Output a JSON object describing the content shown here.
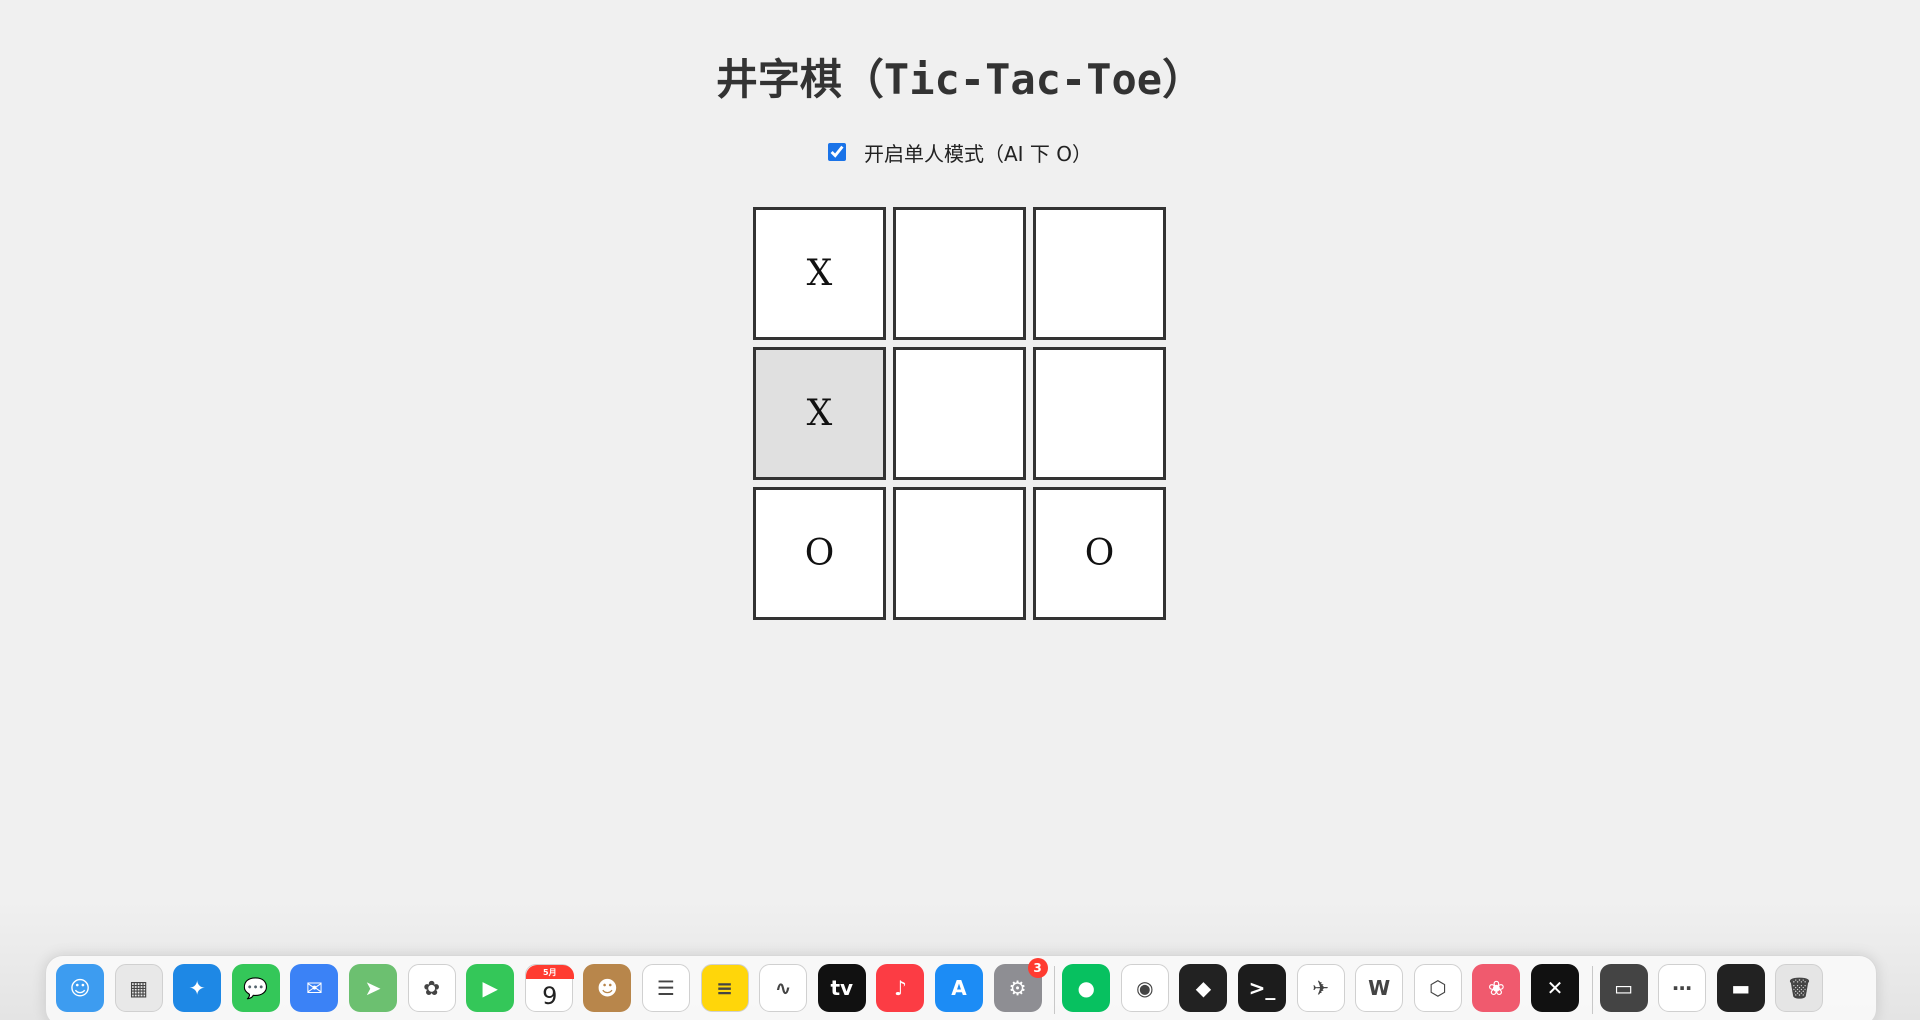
{
  "game": {
    "title": "井字棋（Tic-Tac-Toe）",
    "single_player_label": "开启单人模式（AI 下 O）",
    "single_player_enabled": true,
    "board": [
      "X",
      "",
      "",
      "X",
      "",
      "",
      "O",
      "",
      "O"
    ],
    "highlighted_cell": 3
  },
  "dock": {
    "calendar_month": "5月",
    "calendar_day": "9",
    "settings_badge": "3",
    "icons": [
      {
        "name": "finder-icon",
        "color": "#3d9cf0",
        "glyph": "☺"
      },
      {
        "name": "launchpad-icon",
        "color": "#e8e8e8",
        "glyph": "▦"
      },
      {
        "name": "safari-icon",
        "color": "#1e88e5",
        "glyph": "✦"
      },
      {
        "name": "messages-icon",
        "color": "#34c759",
        "glyph": "💬"
      },
      {
        "name": "mail-icon",
        "color": "#3b82f6",
        "glyph": "✉"
      },
      {
        "name": "maps-icon",
        "color": "#6cc070",
        "glyph": "➤"
      },
      {
        "name": "photos-icon",
        "color": "#ffffff",
        "glyph": "✿"
      },
      {
        "name": "facetime-icon",
        "color": "#34c759",
        "glyph": "▶"
      },
      {
        "name": "calendar-icon",
        "color": "#ffffff",
        "glyph": ""
      },
      {
        "name": "contacts-icon",
        "color": "#b8864b",
        "glyph": "☻"
      },
      {
        "name": "reminders-icon",
        "color": "#ffffff",
        "glyph": "☰"
      },
      {
        "name": "notes-icon",
        "color": "#ffd60a",
        "glyph": "≡"
      },
      {
        "name": "freeform-icon",
        "color": "#ffffff",
        "glyph": "∿"
      },
      {
        "name": "apple-tv-icon",
        "color": "#111111",
        "glyph": "tv"
      },
      {
        "name": "music-icon",
        "color": "#fc3c44",
        "glyph": "♪"
      },
      {
        "name": "app-store-icon",
        "color": "#1c8cf5",
        "glyph": "A"
      },
      {
        "name": "system-settings-icon",
        "color": "#8e8e93",
        "glyph": "⚙"
      },
      {
        "name": "wechat-icon",
        "color": "#07c160",
        "glyph": "●"
      },
      {
        "name": "chrome-icon",
        "color": "#ffffff",
        "glyph": "◉"
      },
      {
        "name": "cube-app-icon",
        "color": "#222222",
        "glyph": "◆"
      },
      {
        "name": "terminal-icon",
        "color": "#1c1c1c",
        "glyph": ">_"
      },
      {
        "name": "bird-app-icon",
        "color": "#ffffff",
        "glyph": "✈"
      },
      {
        "name": "wps-icon",
        "color": "#ffffff",
        "glyph": "W"
      },
      {
        "name": "box-app-icon",
        "color": "#ffffff",
        "glyph": "⬡"
      },
      {
        "name": "flower-app-icon",
        "color": "#f05a6e",
        "glyph": "❀"
      },
      {
        "name": "capcut-icon",
        "color": "#111111",
        "glyph": "✕"
      },
      {
        "name": "recent-window-icon",
        "color": "#444444",
        "glyph": "▭"
      },
      {
        "name": "recent-document-icon",
        "color": "#ffffff",
        "glyph": "⋯"
      },
      {
        "name": "recent-screen-icon",
        "color": "#222222",
        "glyph": "▬"
      },
      {
        "name": "trash-icon",
        "color": "#e5e5e5",
        "glyph": "🗑"
      }
    ]
  }
}
